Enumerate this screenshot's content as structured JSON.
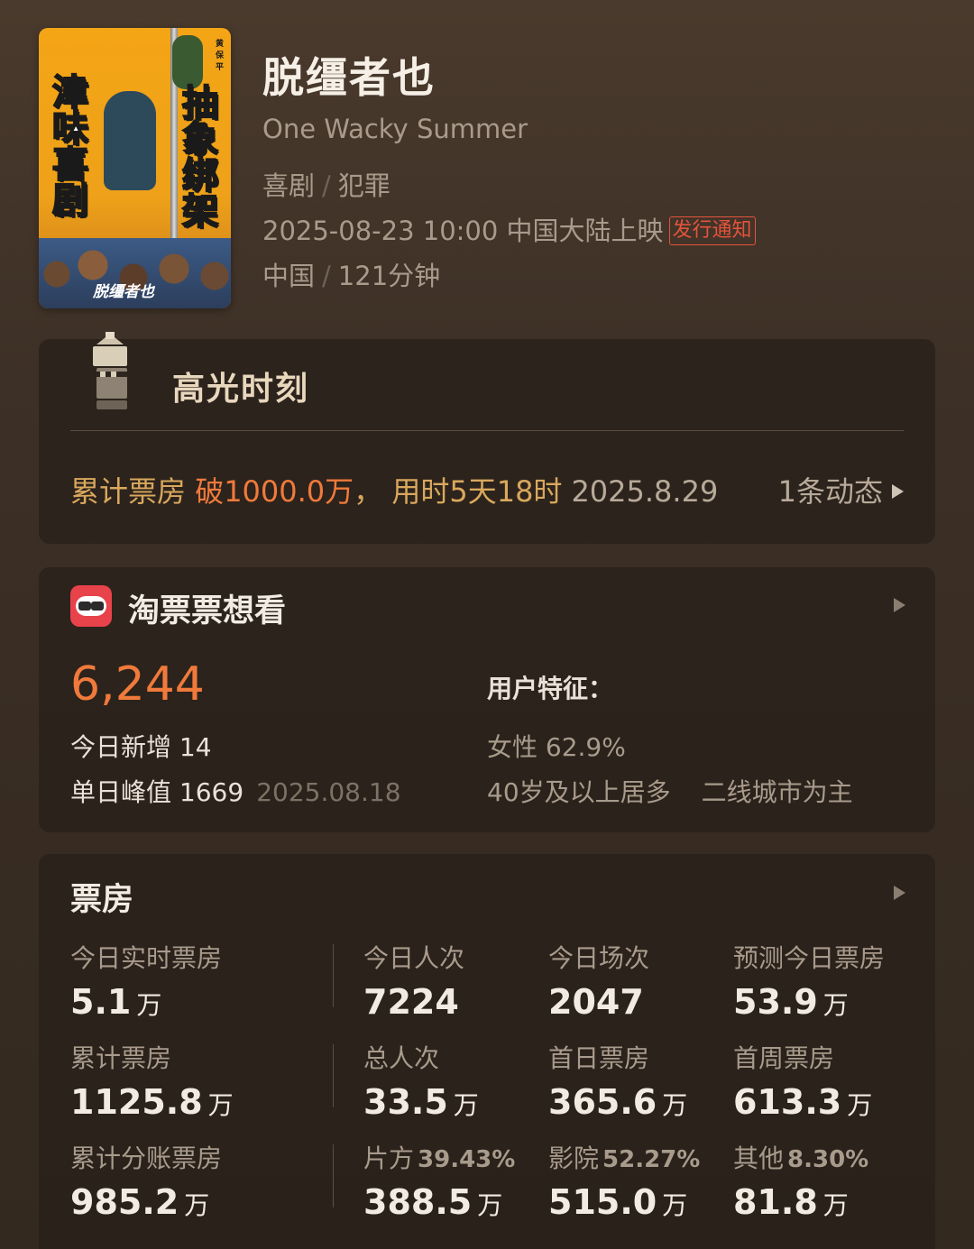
{
  "poster": {
    "left_text": "津味喜剧",
    "right_text": "抽象绑架",
    "logo_text": "脱缰者也",
    "top_mark": "黄保平"
  },
  "movie": {
    "title_cn": "脱缰者也",
    "title_en": "One Wacky Summer",
    "genres": [
      "喜剧",
      "犯罪"
    ],
    "release": "2025-08-23 10:00 中国大陆上映",
    "notice_badge": "发行通知",
    "country": "中国",
    "runtime": "121分钟",
    "separator": "/"
  },
  "highlight": {
    "title": "高光时刻",
    "prefix": "累计票房 ",
    "hot": "破1000.0万",
    "middle": "， 用时5天18时",
    "date": "2025.8.29",
    "dynamics": "1条动态"
  },
  "want": {
    "title": "淘票票想看",
    "count": "6,244",
    "today_new_label": "今日新增",
    "today_new_value": "14",
    "peak_label": "单日峰值",
    "peak_value": "1669",
    "peak_date": "2025.08.18",
    "features_title": "用户特征：",
    "female": "女性 62.9%",
    "age": "40岁及以上居多",
    "city": "二线城市为主"
  },
  "box": {
    "title": "票房",
    "cells": [
      {
        "label": "今日实时票房",
        "pct": "",
        "value": "5.1",
        "unit": "万"
      },
      {
        "label": "今日人次",
        "pct": "",
        "value": "7224",
        "unit": ""
      },
      {
        "label": "今日场次",
        "pct": "",
        "value": "2047",
        "unit": ""
      },
      {
        "label": "预测今日票房",
        "pct": "",
        "value": "53.9",
        "unit": "万"
      },
      {
        "label": "累计票房",
        "pct": "",
        "value": "1125.8",
        "unit": "万"
      },
      {
        "label": "总人次",
        "pct": "",
        "value": "33.5",
        "unit": "万"
      },
      {
        "label": "首日票房",
        "pct": "",
        "value": "365.6",
        "unit": "万"
      },
      {
        "label": "首周票房",
        "pct": "",
        "value": "613.3",
        "unit": "万"
      },
      {
        "label": "累计分账票房",
        "pct": "",
        "value": "985.2",
        "unit": "万"
      },
      {
        "label": "片方",
        "pct": "39.43%",
        "value": "388.5",
        "unit": "万"
      },
      {
        "label": "影院",
        "pct": "52.27%",
        "value": "515.0",
        "unit": "万"
      },
      {
        "label": "其他",
        "pct": "8.30%",
        "value": "81.8",
        "unit": "万"
      }
    ]
  },
  "colors": {
    "accent_orange": "#f07a3b",
    "gold_text": "#d9a85d",
    "badge_red": "#e4533c",
    "taopiaopiao_red": "#e8424b"
  },
  "icons": [
    "clapper-tower-icon",
    "taopiaopiao-icon",
    "chevron-right-icon"
  ]
}
